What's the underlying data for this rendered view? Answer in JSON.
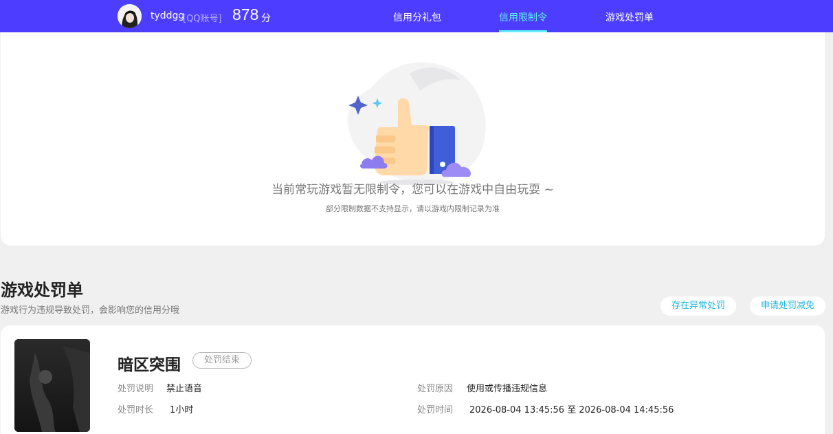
{
  "header": {
    "username": "tyddgg",
    "account_type": "[QQ账号]",
    "score": "878",
    "score_unit": "分",
    "tabs": [
      {
        "label": "信用分礼包",
        "active": false
      },
      {
        "label": "信用限制令",
        "active": true
      },
      {
        "label": "游戏处罚单",
        "active": false
      }
    ],
    "accent_color": "#4d3dff",
    "active_color": "#5ff0ff"
  },
  "empty_state": {
    "icon": "thumbs-up-illustration",
    "title": "当前常玩游戏暂无限制令，您可以在游戏中自由玩耍 ~",
    "subtitle": "部分限制数据不支持显示，请以游戏内限制记录为准"
  },
  "penalty_section": {
    "title": "游戏处罚单",
    "description": "游戏行为违规导致处罚，会影响您的信用分哦",
    "buttons": {
      "report_abnormal": "存在异常处罚",
      "apply_reduction": "申请处罚减免"
    }
  },
  "penalty_item": {
    "game_name": "暗区突围",
    "status": "处罚结束",
    "fields": {
      "desc_label": "处罚说明",
      "desc_value": "禁止语音",
      "reason_label": "处罚原因",
      "reason_value": "使用或传播违规信息",
      "duration_label": "处罚时长",
      "duration_value": "1小时",
      "time_label": "处罚时间",
      "time_value": "2026-08-04 13:45:56 至 2026-08-04 14:45:56"
    }
  }
}
